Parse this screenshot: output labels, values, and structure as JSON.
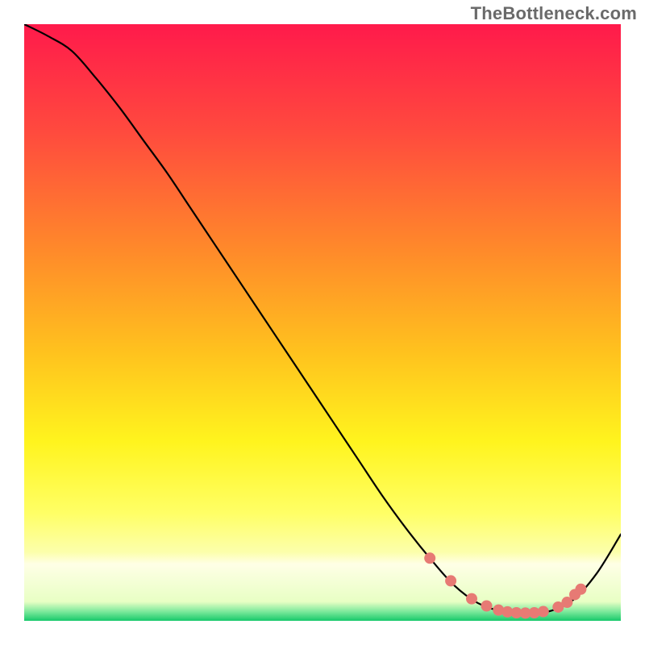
{
  "watermark": "TheBottleneck.com",
  "chart_data": {
    "type": "line",
    "title": "",
    "xlabel": "",
    "ylabel": "",
    "xlim": [
      0,
      100
    ],
    "ylim": [
      0,
      100
    ],
    "grid": false,
    "legend": false,
    "series": [
      {
        "name": "bottleneck-curve",
        "x": [
          0,
          4,
          8,
          12,
          16,
          20,
          24,
          28,
          32,
          36,
          40,
          44,
          48,
          52,
          56,
          60,
          64,
          68,
          72,
          76,
          80,
          84,
          88,
          92,
          96,
          100
        ],
        "y": [
          100,
          98,
          95.5,
          91,
          86,
          80.5,
          75,
          69,
          63,
          57,
          51,
          45,
          39,
          33,
          27,
          21,
          15.5,
          10.5,
          6.0,
          3.0,
          1.6,
          1.3,
          1.6,
          3.5,
          8.0,
          14.5
        ],
        "stroke": "#000000",
        "stroke_width": 2.2
      }
    ],
    "markers": {
      "name": "highlight-dots",
      "x": [
        68,
        71.5,
        75,
        77.5,
        79.5,
        81,
        82.5,
        84,
        85.5,
        87,
        89.5,
        91,
        92.3,
        93.3
      ],
      "y": [
        10.5,
        6.7,
        3.7,
        2.5,
        1.8,
        1.5,
        1.35,
        1.3,
        1.35,
        1.55,
        2.3,
        3.1,
        4.4,
        5.3
      ],
      "color": "#e77a74",
      "radius": 7.0
    },
    "background_gradient": {
      "type": "vertical",
      "stops": [
        {
          "offset": 0.0,
          "color": "#ff1a4b"
        },
        {
          "offset": 0.18,
          "color": "#ff4a3e"
        },
        {
          "offset": 0.38,
          "color": "#ff8a2a"
        },
        {
          "offset": 0.55,
          "color": "#ffc21e"
        },
        {
          "offset": 0.7,
          "color": "#fff41e"
        },
        {
          "offset": 0.82,
          "color": "#ffff66"
        },
        {
          "offset": 0.885,
          "color": "#fcffab"
        },
        {
          "offset": 0.905,
          "color": "#ffffe6"
        },
        {
          "offset": 0.968,
          "color": "#e8ffc4"
        },
        {
          "offset": 0.985,
          "color": "#79e89a"
        },
        {
          "offset": 1.0,
          "color": "#17c96b"
        }
      ]
    }
  }
}
